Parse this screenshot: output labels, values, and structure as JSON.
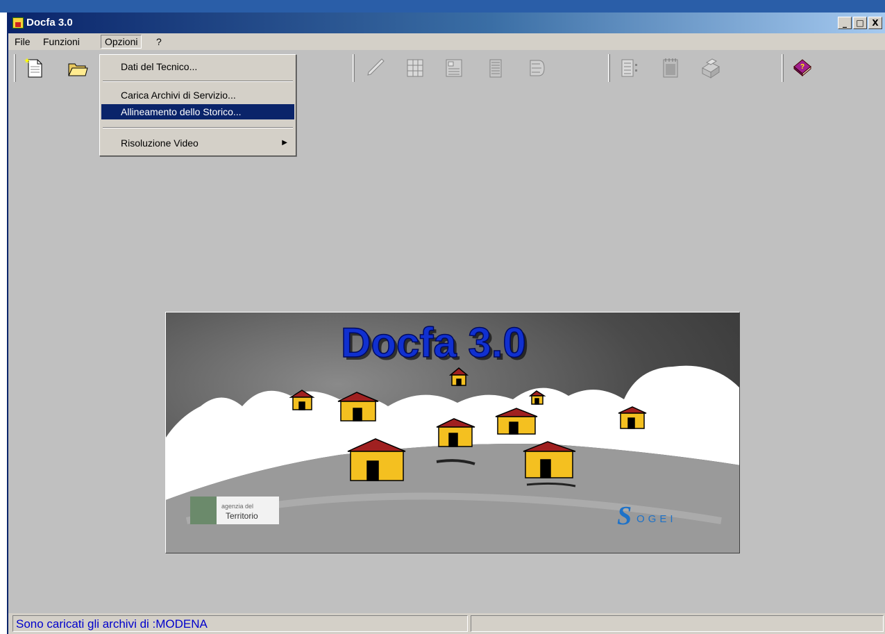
{
  "window": {
    "title": "Docfa 3.0",
    "controls": [
      "_",
      "□",
      "X"
    ]
  },
  "menubar": {
    "items": [
      "File",
      "Funzioni",
      "Opzioni",
      "?"
    ]
  },
  "dropdown": {
    "items": [
      {
        "label": "Dati del Tecnico..."
      },
      {
        "label": "Carica Archivi di Servizio..."
      },
      {
        "label": "Allineamento dello Storico..."
      },
      {
        "label": "Risoluzione Video",
        "submenu": true
      }
    ],
    "highlighted": "Allineamento dello Storico..."
  },
  "toolbar": {
    "icons": [
      "new-document-icon",
      "open-folder-icon",
      "edit-pen-icon",
      "grid-icon",
      "form-icon",
      "list-icon",
      "stack-icon",
      "layout-icon",
      "calendar-icon",
      "printer-icon",
      "help-book-icon"
    ]
  },
  "splash": {
    "title": "Docfa 3.0",
    "agency_line1": "agenzia del",
    "agency_line2": "Territorio",
    "vendor": "OGEI",
    "vendor_initial": "S"
  },
  "statusbar": {
    "left": "Sono caricati gli archivi di :MODENA",
    "right": ""
  },
  "colors": {
    "title_active": "#0a246a",
    "status_text": "#0000cc",
    "splash_title": "#1030d0"
  }
}
